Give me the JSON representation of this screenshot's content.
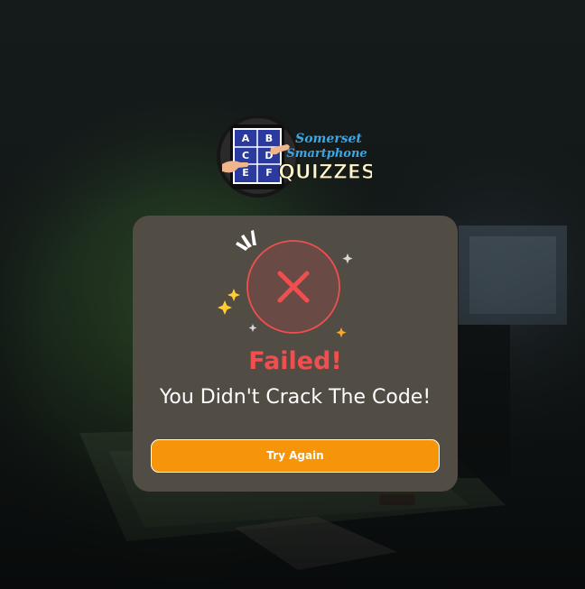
{
  "logo": {
    "brand_line1": "Somerset",
    "brand_line2": "Smartphone",
    "brand_line3": "QUIZZES",
    "grid_letters": [
      "A",
      "B",
      "C",
      "D",
      "E",
      "F"
    ]
  },
  "result": {
    "title": "Failed!",
    "message": "You Didn't Crack The Code!",
    "status_icon": "close-x-icon",
    "button_label": "Try Again"
  },
  "colors": {
    "modal_bg": "#514c44",
    "fail_red": "#ef4f4f",
    "button_orange": "#f6950a",
    "text_white": "#ffffff"
  }
}
